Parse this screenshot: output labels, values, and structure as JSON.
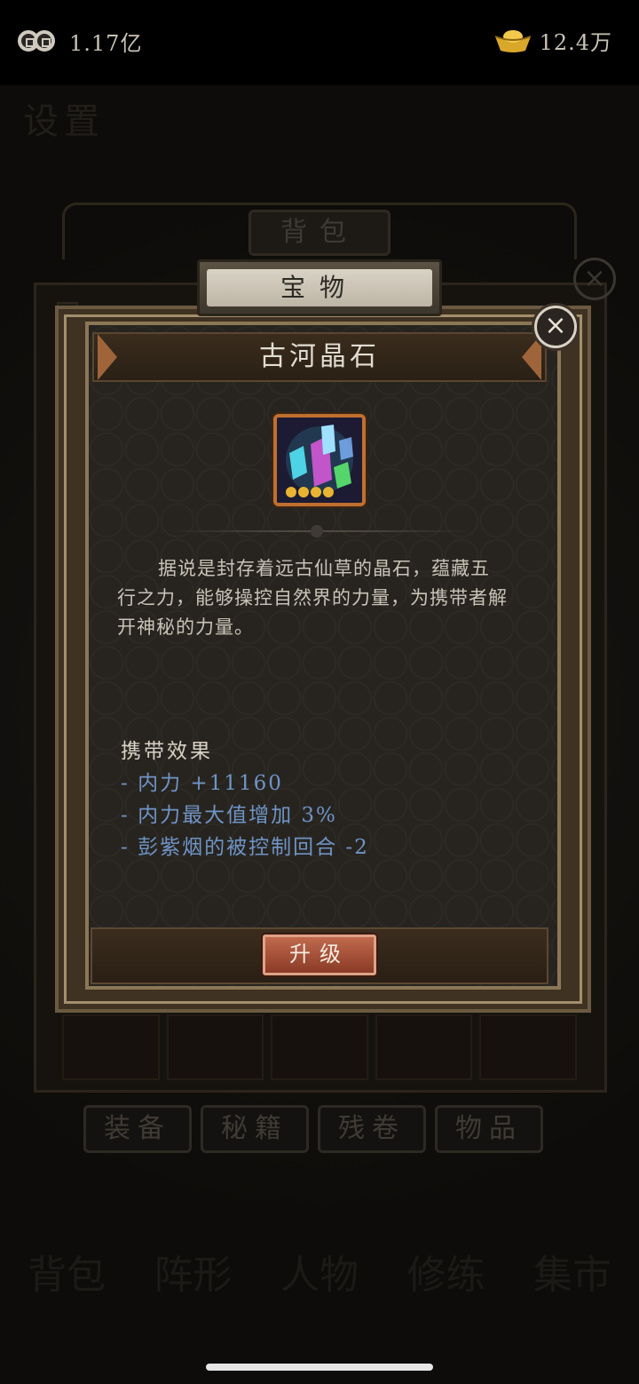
{
  "currency": {
    "coins": "1.17亿",
    "ingots": "12.4万"
  },
  "background": {
    "setting_label": "设置",
    "panel_title": "背包",
    "tabs": [
      "装备",
      "秘籍",
      "残卷",
      "物品"
    ],
    "nav": [
      "背包",
      "阵形",
      "人物",
      "修练",
      "集市"
    ]
  },
  "modal": {
    "tab_label": "宝物",
    "item_name": "古河晶石",
    "description": "据说是封存着远古仙草的晶石，蕴藏五行之力，能够操控自然界的力量，为携带者解开神秘的力量。",
    "effects_title": "携带效果",
    "effects": [
      "- 内力 +11160",
      "- 内力最大值增加 3%",
      "- 彭紫烟的被控制回合 -2"
    ],
    "upgrade_label": "升级",
    "close_symbol": "×"
  },
  "colors": {
    "effect_text": "#6f94c6",
    "upgrade_button": "#a34c35",
    "frame_gold": "#a38f6c"
  }
}
